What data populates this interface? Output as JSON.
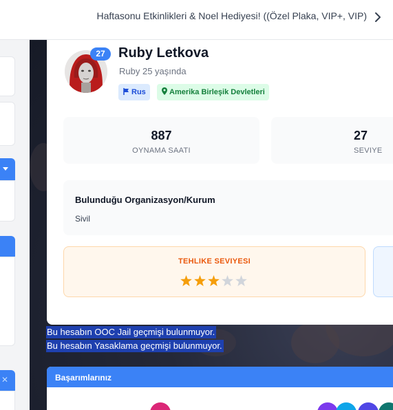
{
  "topbar": {
    "announcement": "Haftasonu Etkinlikleri & Noel Hediyesi! ((Özel Plaka, VIP+, VIP)"
  },
  "profile": {
    "level": "27",
    "name": "Ruby Letkova",
    "age_text": "Ruby 25 yaşında",
    "tags": {
      "ethnicity": "Rus",
      "country": "Amerika Birleşik Devletleri"
    },
    "stats": [
      {
        "value": "887",
        "label": "OYNAMA SAATI"
      },
      {
        "value": "27",
        "label": "SEVIYE"
      }
    ],
    "organization": {
      "title": "Bulunduğu Organizasyon/Kurum",
      "value": "Sivil"
    },
    "danger": {
      "title": "TEHLIKE SEVIYESI",
      "rating": 3,
      "max": 5
    }
  },
  "notes": {
    "ooc_jail": "Bu hesabın OOC Jail geçmişi bulunmuyor.",
    "ban": "Bu hesabın Yasaklama geçmişi bulunmuyor."
  },
  "achievements": {
    "title": "Başarımlarınız"
  },
  "colors": {
    "accent": "#3b82f6",
    "danger_text": "#ea580c",
    "star_on": "#f59e0b",
    "star_off": "#d1d5db",
    "selection": "#1e40af"
  }
}
